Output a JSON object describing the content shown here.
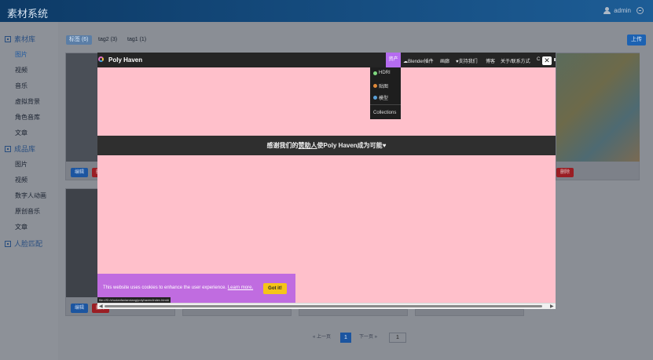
{
  "app": {
    "title": "素材系统",
    "user": "admin"
  },
  "sidebar": {
    "group1": "素材库",
    "group1_items": [
      "图片",
      "视频",
      "音乐",
      "虚拟背景",
      "角色音库",
      "文章"
    ],
    "group2": "成品库",
    "group2_items": [
      "图片",
      "视频",
      "数字人动画",
      "原创音乐",
      "文章"
    ],
    "face": "人脸匹配"
  },
  "tags": [
    "标签 (6)",
    "tag2 (3)",
    "tag1 (1)"
  ],
  "upload": "上传",
  "card": {
    "edit": "编辑",
    "delete": "删除"
  },
  "pager": {
    "prev": "« 上一页",
    "next": "下一页 »",
    "current": "1",
    "jump": "1"
  },
  "modal": {
    "brand": "Poly Haven",
    "nav": {
      "assets": "资产",
      "blender": "Blender插件",
      "gallery": "画廊",
      "support": "支持我们",
      "blog": "博客",
      "about": "关于/联系方式",
      "more": "C"
    },
    "dropdown": [
      {
        "label": "HDRI",
        "color": "#7fd87f"
      },
      {
        "label": "贴图",
        "color": "#e08a3a"
      },
      {
        "label": "模型",
        "color": "#5aa0d8"
      },
      {
        "label": "Collections",
        "color": ""
      }
    ],
    "banner_pre": "感谢我们的",
    "banner_link": "赞助人",
    "banner_post": "使Poly Haven成为可能",
    "cookie_text": "This website uses cookies to enhance the user experience.",
    "cookie_link": "Learn more.",
    "got_it": "Got it!",
    "status_url": "file:///D:/zhudanfaxianxiang/polyhaven/index.html#"
  }
}
